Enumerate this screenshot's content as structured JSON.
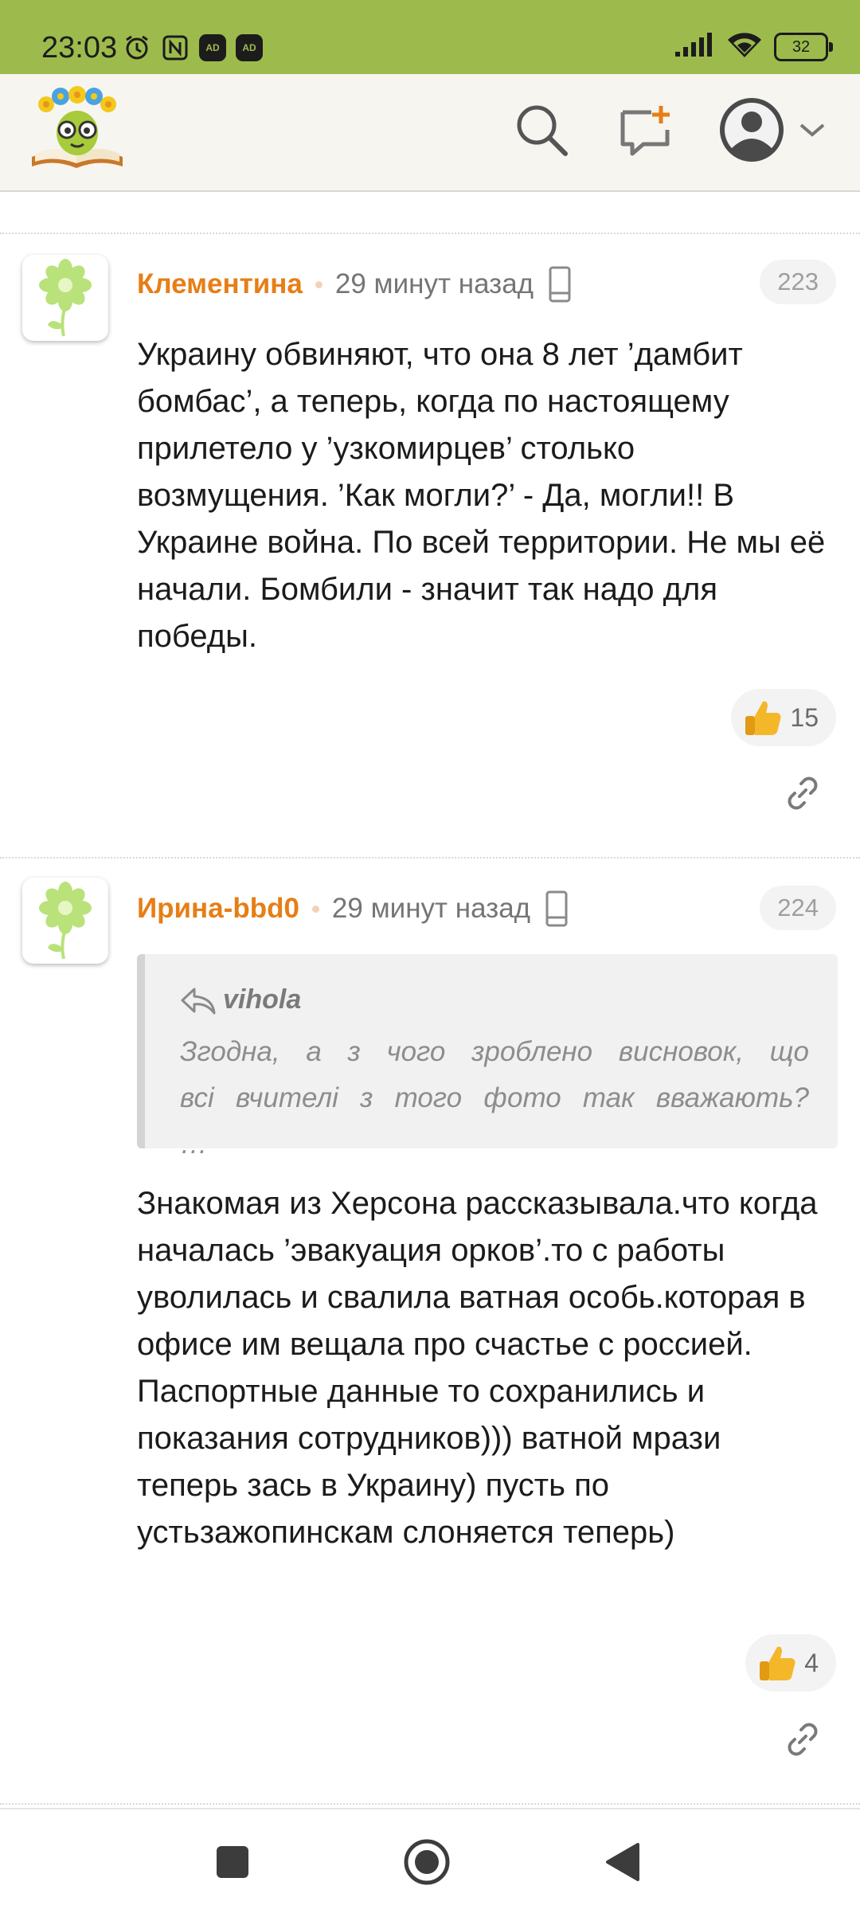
{
  "status_bar": {
    "time": "23:03",
    "icons": [
      "alarm-icon",
      "nfc-icon",
      "ad-blocker-icon",
      "ad-blocker-icon"
    ],
    "ad_badge": "AD",
    "battery": "32",
    "bg_color": "#9dbb4c"
  },
  "header": {
    "icons": [
      "site-logo",
      "search-icon",
      "new-message-icon",
      "user-avatar-icon",
      "chevron-down-icon"
    ],
    "bg_color": "#f6f5f0"
  },
  "comments": [
    {
      "author": "Клементина",
      "time_ago": "29 минут назад",
      "number": "223",
      "text": "Украину обвиняют, что она 8 лет ’дамбит бомбас’, а теперь, когда по настоящему прилетело у ’узкомирцев’ столько возмущения. ’Как могли?’ - Да, могли!! В Украине война. По всей территории. Не мы её начали. Бомбили - значит так надо для победы.",
      "likes": "15"
    },
    {
      "author": "Ирина-bbd0",
      "time_ago": "29 минут назад",
      "number": "224",
      "quote_author": "vihola",
      "quote_text": "Згодна, а з чого зроблено висновок, що всі вчителі з того фото так вважають? …",
      "text": "Знакомая из Херсона рассказывала.что когда началась ’эвакуация орков’.то с работы уволилась и свалила ватная особь.которая в офисе им вещала про счастье с россией. Паспортные данные то сохранились и показания сотрудников))) ватной мрази теперь зась в Украину) пусть по устьзажопинскам слоняется теперь)",
      "likes": "4"
    }
  ],
  "colors": {
    "author": "#e67e16",
    "meta": "#757575",
    "text": "#1b1b1b"
  },
  "nav_bar": {
    "icons": [
      "recents-square-icon",
      "home-circle-icon",
      "back-triangle-icon"
    ]
  }
}
